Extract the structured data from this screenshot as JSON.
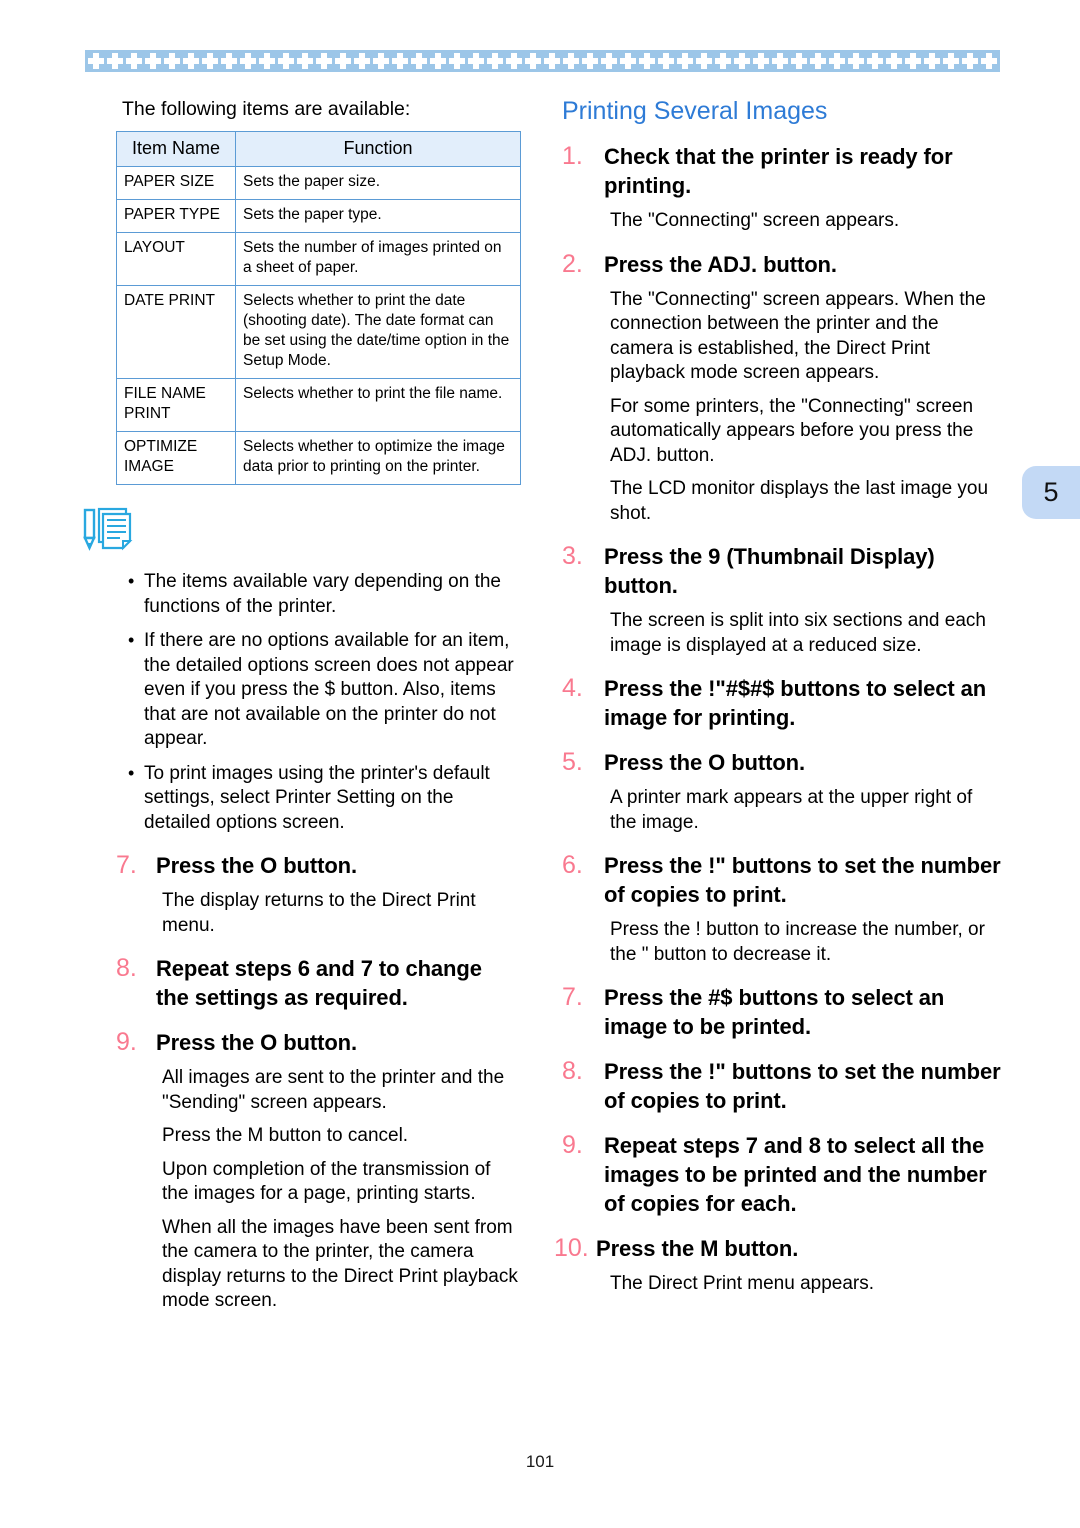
{
  "page": {
    "number": "101",
    "tab_label": "5"
  },
  "left_column": {
    "intro": "The following items are available:",
    "table": {
      "headers": [
        "Item Name",
        "Function"
      ],
      "rows": [
        {
          "name": "PAPER SIZE",
          "function": "Sets the paper size."
        },
        {
          "name": "PAPER TYPE",
          "function": "Sets the paper type."
        },
        {
          "name": "LAYOUT",
          "function": "Sets the number of images printed on a sheet of paper."
        },
        {
          "name": "DATE PRINT",
          "function": "Selects whether to print the date (shooting date). The date format can be set using the date/time option in the Setup Mode."
        },
        {
          "name": "FILE NAME\nPRINT",
          "function": "Selects whether to print the file name."
        },
        {
          "name": "OPTIMIZE\nIMAGE",
          "function": "Selects whether to optimize the image data prior to printing on the printer."
        }
      ]
    },
    "note": {
      "icon": "note-pencil-document-icon",
      "bullets": [
        "The items available vary depending on the functions of the printer.",
        "If there are no options available for an item, the detailed options screen does not appear even if you press the $ button. Also, items that are not available on the printer do not appear.",
        "To print images using the printer's default settings, select Printer Setting on the detailed options screen."
      ]
    },
    "steps": [
      {
        "number": "7.",
        "title": "Press the O   button.",
        "body": [
          "The display returns to the Direct Print menu."
        ]
      },
      {
        "number": "8.",
        "title": "Repeat steps 6 and 7 to change the settings as required.",
        "body": []
      },
      {
        "number": "9.",
        "title": "Press the O   button.",
        "body": [
          "All images are sent to the printer and the \"Sending\" screen appears.",
          "Press the M        button to cancel.",
          "Upon completion of the transmission of the images for a page, printing starts.",
          "When all the images have been sent from the camera to the printer, the camera display returns to the Direct Print playback mode screen."
        ]
      }
    ]
  },
  "right_column": {
    "heading": "Printing Several Images",
    "steps": [
      {
        "number": "1.",
        "title": "Check that the printer is ready for printing.",
        "body": [
          "The \"Connecting\" screen appears."
        ]
      },
      {
        "number": "2.",
        "title": "Press the ADJ. button.",
        "body": [
          "The \"Connecting\" screen appears. When the connection between the printer and the camera is established, the Direct Print playback mode screen appears.",
          "For some printers, the \"Connecting\" screen automatically appears before you press the ADJ. button.",
          "The LCD monitor displays the last image you shot."
        ]
      },
      {
        "number": "3.",
        "title": "Press the 9  (Thumbnail Display) button.",
        "body": [
          "The screen is split into six sections and each image is displayed at a reduced size."
        ]
      },
      {
        "number": "4.",
        "title": "Press the !\"#$#$   buttons to select an image for printing.",
        "body": []
      },
      {
        "number": "5.",
        "title": "Press the O   button.",
        "body": [
          "A printer mark appears at the upper right of the image."
        ]
      },
      {
        "number": "6.",
        "title": "Press the !\"    buttons to set the number of copies to print.",
        "body": [
          "Press the !  button to increase the number, or the \"  button to decrease it."
        ]
      },
      {
        "number": "7.",
        "title": "Press the #$  buttons to select an image to be printed.",
        "body": []
      },
      {
        "number": "8.",
        "title": "Press the !\"   buttons to set the number of copies to print.",
        "body": []
      },
      {
        "number": "9.",
        "title": "Repeat steps 7 and 8 to select all the images to be printed and the number of copies for each.",
        "body": []
      },
      {
        "number": "10.",
        "title": "Press the M       button.",
        "body": [
          "The Direct Print menu appears."
        ]
      }
    ]
  }
}
